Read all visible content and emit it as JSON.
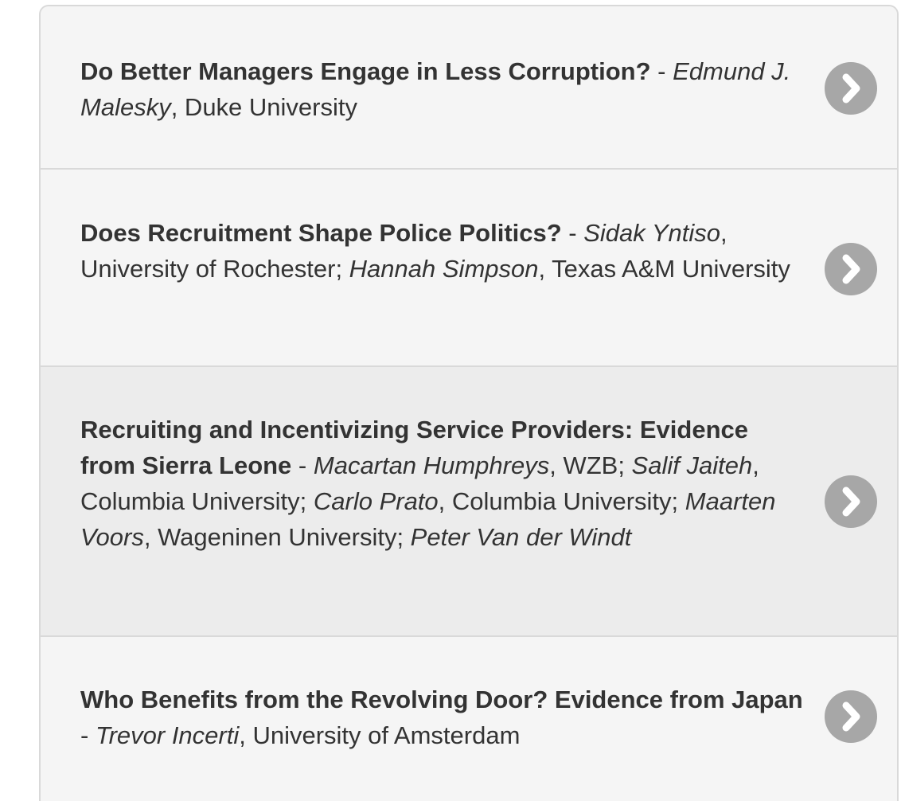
{
  "items": [
    {
      "title": "Do Better Managers Engage in Less Corruption?",
      "separator": " - ",
      "authors": [
        {
          "name": "Edmund J. Malesky",
          "affiliation": ", Duke University"
        }
      ]
    },
    {
      "title": "Does Recruitment Shape Police Politics?",
      "separator": " - ",
      "authors": [
        {
          "name": "Sidak Yntiso",
          "affiliation": ", University of Rochester; "
        },
        {
          "name": "Hannah Simpson",
          "affiliation": ", Texas A&M University"
        }
      ]
    },
    {
      "title": "Recruiting and Incentivizing Service Providers: Evidence from Sierra Leone",
      "separator": " - ",
      "authors": [
        {
          "name": "Macartan Humphreys",
          "affiliation": ", WZB; "
        },
        {
          "name": "Salif Jaiteh",
          "affiliation": ", Columbia University; "
        },
        {
          "name": "Carlo Prato",
          "affiliation": ", Columbia University; "
        },
        {
          "name": "Maarten Voors",
          "affiliation": ", Wageninen University; "
        },
        {
          "name": "Peter Van der Windt",
          "affiliation": ""
        }
      ]
    },
    {
      "title": "Who Benefits from the Revolving Door? Evidence from Japan",
      "separator": " - ",
      "authors": [
        {
          "name": "Trevor Incerti",
          "affiliation": ", University of Amsterdam"
        }
      ]
    }
  ],
  "icons": {
    "chevron": "chevron-right-circle-icon"
  },
  "colors": {
    "text": "#333333",
    "row_background": "#f5f5f5",
    "row_hover_background": "#ececec",
    "divider": "#d9d9d9",
    "chevron_circle": "#a7a7a7",
    "chevron_glyph": "#ffffff"
  }
}
